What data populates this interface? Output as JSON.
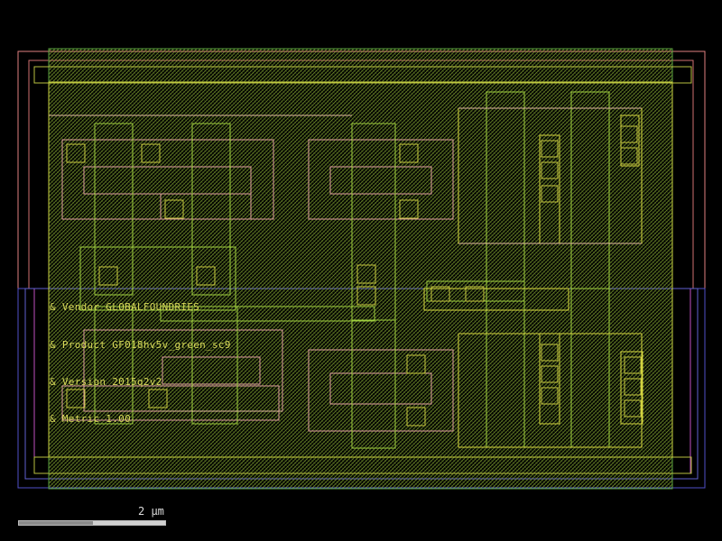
{
  "canvas": {
    "background": "#000000"
  },
  "layers": {
    "nwell": "#e08080",
    "pwell": "#5050c8",
    "implant": "#c050c0",
    "diffusion": "#7fbf3f",
    "poly": "#e0a0a0",
    "metal1": "#d8d840",
    "contact": "#b0b040",
    "boundary": "#50a050"
  },
  "annotations": {
    "vendor": "& Vendor GLOBALFOUNDRIES",
    "product": "& Product GF018hv5v_green_sc9",
    "version": "& Version 2015q2v2",
    "metric": "& Metric 1.00"
  },
  "scale": {
    "label": "2 μm"
  }
}
